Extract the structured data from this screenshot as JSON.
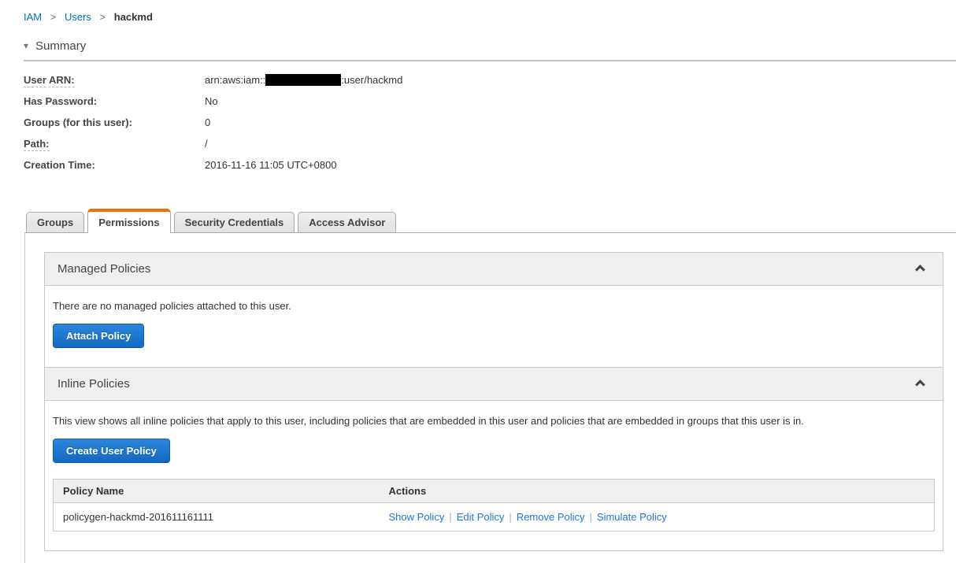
{
  "breadcrumb": {
    "separator": ">",
    "items": [
      "IAM",
      "Users",
      "hackmd"
    ]
  },
  "summary": {
    "title": "Summary",
    "collapse_icon": "▾",
    "fields": {
      "user_arn": {
        "label": "User ARN:",
        "value_prefix": "arn:aws:iam::",
        "value_redacted": "account-id-hidden",
        "value_suffix": ":user/hackmd"
      },
      "has_password": {
        "label": "Has Password:",
        "value": "No"
      },
      "groups": {
        "label": "Groups (for this user):",
        "value": "0"
      },
      "path": {
        "label": "Path:",
        "value": "/"
      },
      "creation_time": {
        "label": "Creation Time:",
        "value": "2016-11-16 11:05 UTC+0800"
      }
    }
  },
  "tabs": [
    {
      "label": "Groups",
      "active": false
    },
    {
      "label": "Permissions",
      "active": true
    },
    {
      "label": "Security Credentials",
      "active": false
    },
    {
      "label": "Access Advisor",
      "active": false
    }
  ],
  "managed_policies": {
    "title": "Managed Policies",
    "empty_message": "There are no managed policies attached to this user.",
    "attach_button_label": "Attach Policy"
  },
  "inline_policies": {
    "title": "Inline Policies",
    "description": "This view shows all inline policies that apply to this user, including policies that are embedded in this user and policies that are embedded in groups that this user is in.",
    "create_button_label": "Create User Policy",
    "table": {
      "headers": [
        "Policy Name",
        "Actions"
      ],
      "action_separator": "|",
      "rows": [
        {
          "policy_name": "policygen-hackmd-201611161111",
          "actions": [
            "Show Policy",
            "Edit Policy",
            "Remove Policy",
            "Simulate Policy"
          ]
        }
      ]
    }
  },
  "colors": {
    "accent_orange": "#ec7211",
    "breadcrumb_link_blue": "#0073bb",
    "action_link_blue": "#1f74d8",
    "button_blue": "#1c7cd6",
    "section_header_gray": "#f0f0f0"
  }
}
